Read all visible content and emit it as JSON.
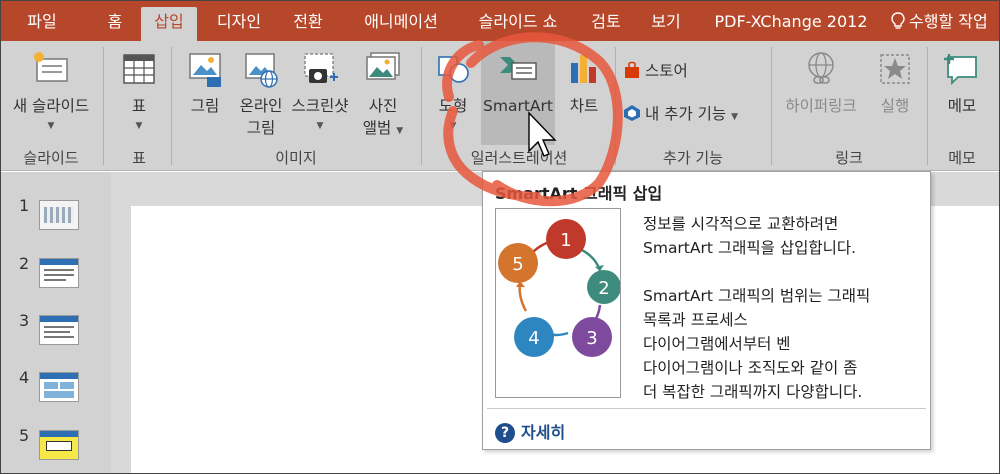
{
  "tabs": [
    {
      "label": "파일"
    },
    {
      "label": "홈"
    },
    {
      "label": "삽입",
      "active": true
    },
    {
      "label": "디자인"
    },
    {
      "label": "전환"
    },
    {
      "label": "애니메이션"
    },
    {
      "label": "슬라이드 쇼"
    },
    {
      "label": "검토"
    },
    {
      "label": "보기"
    },
    {
      "label": "PDF-XChange 2012"
    }
  ],
  "tell_me": "수행할 작업",
  "ribbon": {
    "new_slide": {
      "line1": "새 슬라이드",
      "icon": "new-slide-icon"
    },
    "table": {
      "line1": "표",
      "icon": "table-icon"
    },
    "picture": {
      "line1": "그림",
      "icon": "picture-icon"
    },
    "online_picture": {
      "line1": "온라인",
      "line2": "그림",
      "icon": "online-picture-icon"
    },
    "screenshot": {
      "line1": "스크린샷",
      "icon": "screenshot-icon"
    },
    "photo_album": {
      "line1": "사진",
      "line2": "앨범",
      "icon": "photo-album-icon"
    },
    "shapes": {
      "line1": "도형",
      "icon": "shapes-icon"
    },
    "smartart": {
      "line1": "SmartArt",
      "icon": "smartart-icon"
    },
    "chart": {
      "line1": "차트",
      "icon": "chart-icon"
    },
    "store": {
      "label": "스토어",
      "icon": "store-icon"
    },
    "my_addins": {
      "label": "내 추가 기능",
      "icon": "my-addins-icon"
    },
    "hyperlink": {
      "line1": "하이퍼링크",
      "icon": "hyperlink-icon"
    },
    "action": {
      "line1": "실행",
      "icon": "action-icon"
    },
    "comment": {
      "line1": "메모",
      "icon": "comment-icon"
    },
    "groups": {
      "slides": "슬라이드",
      "tables": "표",
      "images": "이미지",
      "illustrations": "일러스트레이션",
      "addins": "추가 기능",
      "links": "링크",
      "comments": "메모"
    }
  },
  "slides": [
    {
      "num": "1"
    },
    {
      "num": "2"
    },
    {
      "num": "3"
    },
    {
      "num": "4"
    },
    {
      "num": "5"
    }
  ],
  "tooltip": {
    "title": "SmartArt 그래픽 삽입",
    "lines": [
      "정보를 시각적으로 교환하려면",
      "SmartArt 그래픽을 삽입합니다.",
      "",
      "SmartArt 그래픽의 범위는 그래픽",
      "목록과 프로세스",
      "다이어그램에서부터 벤",
      "다이어그램이나 조직도와 같이 좀",
      "더 복잡한 그래픽까지 다양합니다."
    ],
    "cycle_labels": [
      "1",
      "2",
      "3",
      "4",
      "5"
    ],
    "more": "자세히"
  },
  "colors": {
    "accent": "#b7472a",
    "ribbon_bg": "#d2d2d2",
    "annotation": "#e8573c",
    "cycle": [
      "#c0392b",
      "#3d8b7d",
      "#7d4a9e",
      "#2e86c1",
      "#d4752e"
    ]
  }
}
